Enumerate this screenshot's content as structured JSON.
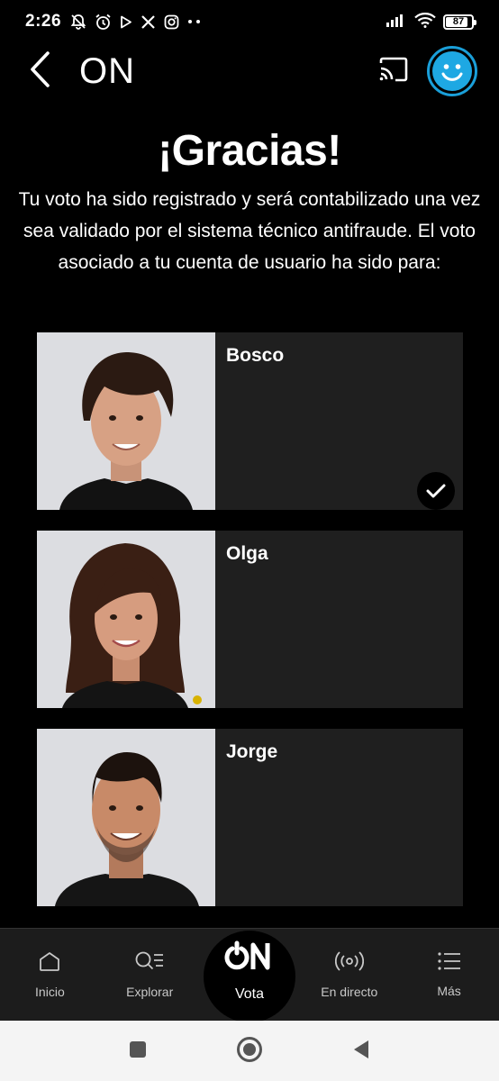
{
  "status_bar": {
    "time": "2:26",
    "battery_level": "87",
    "battery_fraction": 0.87,
    "left_icons": [
      "mute-bell-icon",
      "alarm-icon",
      "play-store-icon",
      "x-icon",
      "instagram-icon",
      "more-dots-icon"
    ],
    "right_icons": [
      "signal-icon",
      "wifi-icon",
      "battery-icon"
    ]
  },
  "app_bar": {
    "title": "ON",
    "back_icon": "chevron-left-icon",
    "cast_icon": "cast-icon",
    "avatar_icon": "smiley-avatar-icon",
    "accent_color": "#1ea8e3"
  },
  "content": {
    "title": "¡Gracias!",
    "message": "Tu voto ha sido registrado y será contabilizado una vez sea validado por el sistema técnico antifraude. El voto asociado a tu cuenta de usuario ha sido para:"
  },
  "candidates": [
    {
      "name": "Bosco",
      "selected": true
    },
    {
      "name": "Olga",
      "selected": false
    },
    {
      "name": "Jorge",
      "selected": false
    }
  ],
  "bottom_nav": {
    "items": [
      {
        "label": "Inicio",
        "icon": "home-icon"
      },
      {
        "label": "Explorar",
        "icon": "explore-search-icon"
      },
      {
        "label": "Vota",
        "icon": "on-logo-icon",
        "active": true,
        "logo_text": "ON"
      },
      {
        "label": "En directo",
        "icon": "live-broadcast-icon"
      },
      {
        "label": "Más",
        "icon": "menu-list-icon"
      }
    ]
  },
  "system_nav": {
    "icons": [
      "recents-square-icon",
      "home-circle-icon",
      "back-triangle-icon"
    ]
  }
}
